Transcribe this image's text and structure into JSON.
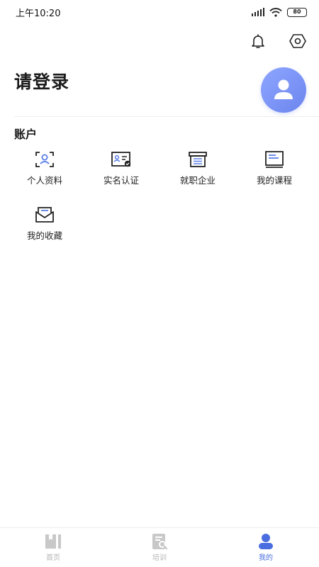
{
  "status_bar": {
    "time": "上午10:20",
    "battery": "80"
  },
  "header": {
    "title": "请登录"
  },
  "account": {
    "section_title": "账户",
    "items": [
      {
        "label": "个人资料",
        "icon": "profile-card-icon"
      },
      {
        "label": "实名认证",
        "icon": "id-verify-icon"
      },
      {
        "label": "就职企业",
        "icon": "company-icon"
      },
      {
        "label": "我的课程",
        "icon": "course-book-icon"
      },
      {
        "label": "我的收藏",
        "icon": "favorites-mail-icon"
      }
    ]
  },
  "tabbar": {
    "tabs": [
      {
        "label": "首页",
        "active": false,
        "icon": "home-book-icon"
      },
      {
        "label": "培训",
        "active": false,
        "icon": "training-doc-icon"
      },
      {
        "label": "我的",
        "active": true,
        "icon": "user-icon"
      }
    ]
  },
  "colors": {
    "accent": "#4a6ee0",
    "avatar_bg": "#7b93f3",
    "icon_blue": "#5b7fe8",
    "tab_inactive": "#c8c8c8"
  }
}
